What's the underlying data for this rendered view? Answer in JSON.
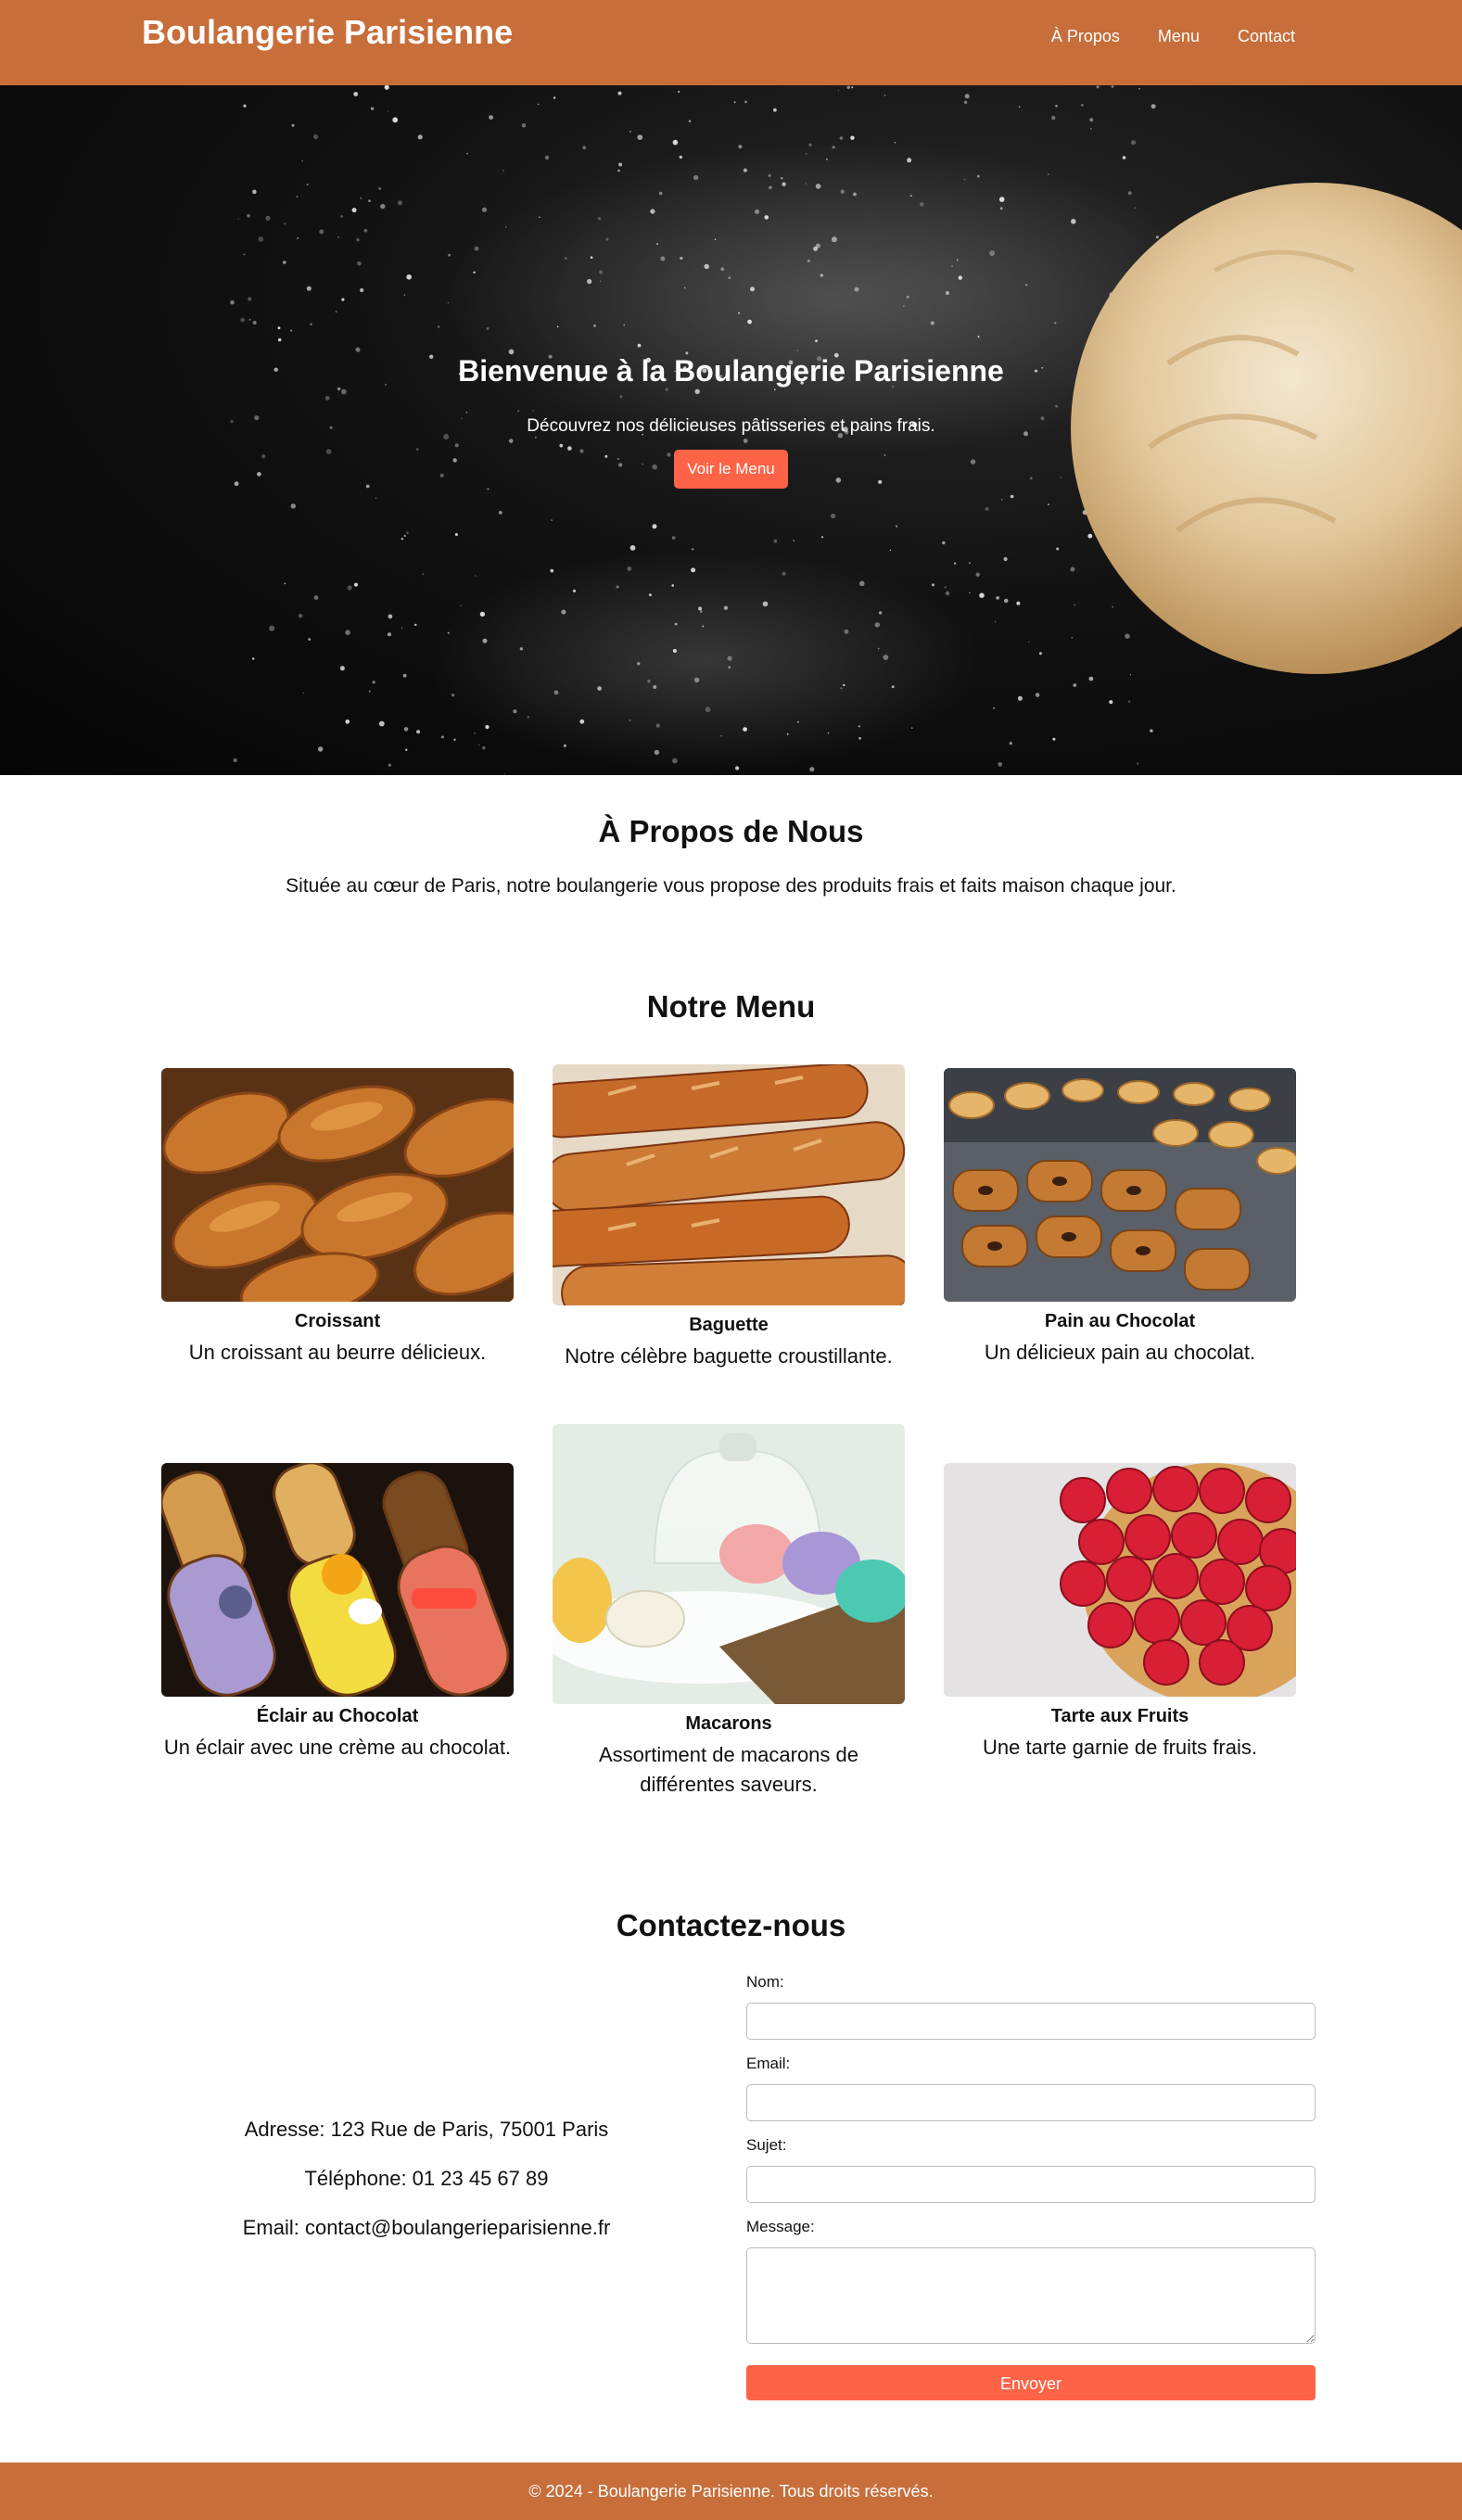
{
  "header": {
    "brand": "Boulangerie Parisienne",
    "nav": [
      "À Propos",
      "Menu",
      "Contact"
    ]
  },
  "hero": {
    "title": "Bienvenue à la Boulangerie Parisienne",
    "subtitle": "Découvrez nos délicieuses pâtisseries et pains frais.",
    "button": "Voir le Menu"
  },
  "about": {
    "title": "À Propos de Nous",
    "text": "Située au cœur de Paris, notre boulangerie vous propose des produits frais et faits maison chaque jour."
  },
  "menu": {
    "title": "Notre Menu",
    "items": [
      {
        "name": "Croissant",
        "desc": "Un croissant au beurre délicieux.",
        "image": "croissant-photo"
      },
      {
        "name": "Baguette",
        "desc": "Notre célèbre baguette croustillante.",
        "image": "baguette-photo"
      },
      {
        "name": "Pain au Chocolat",
        "desc": "Un délicieux pain au chocolat.",
        "image": "pain-au-chocolat-photo"
      },
      {
        "name": "Éclair au Chocolat",
        "desc": "Un éclair avec une crème au chocolat.",
        "image": "eclair-photo"
      },
      {
        "name": "Macarons",
        "desc": "Assortiment de macarons de différentes saveurs.",
        "image": "macarons-photo"
      },
      {
        "name": "Tarte aux Fruits",
        "desc": "Une tarte garnie de fruits frais.",
        "image": "tarte-photo"
      }
    ]
  },
  "contact": {
    "title": "Contactez-nous",
    "address": "Adresse: 123 Rue de Paris, 75001 Paris",
    "phone": "Téléphone: 01 23 45 67 89",
    "email": "Email: contact@boulangerieparisienne.fr",
    "form": {
      "name_label": "Nom:",
      "email_label": "Email:",
      "subject_label": "Sujet:",
      "message_label": "Message:",
      "name_value": "",
      "email_value": "",
      "subject_value": "",
      "message_value": "",
      "submit": "Envoyer"
    }
  },
  "footer": {
    "text": "© 2024 - Boulangerie Parisienne. Tous droits réservés."
  },
  "colors": {
    "header_bg": "#c76e3a",
    "accent": "#ff6347"
  }
}
